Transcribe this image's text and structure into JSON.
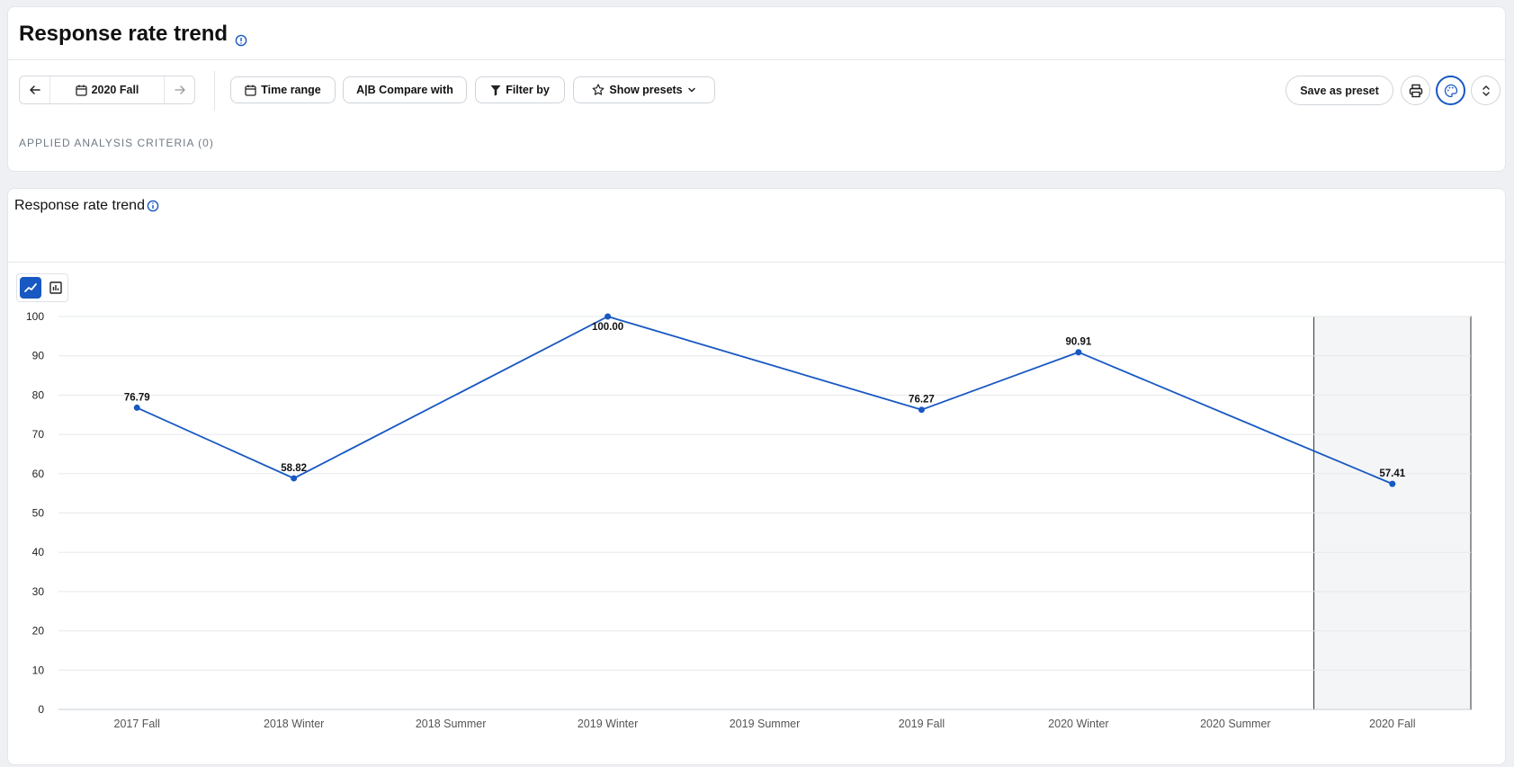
{
  "header": {
    "title": "Response rate trend",
    "period": "2020 Fall",
    "buttons": {
      "time_range": "Time range",
      "compare": "A|B Compare with",
      "filter": "Filter by",
      "presets": "Show presets",
      "save_preset": "Save as preset"
    },
    "criteria": "APPLIED ANALYSIS CRITERIA (0)"
  },
  "chart_card": {
    "title": "Response rate trend"
  },
  "colors": {
    "accent": "#1858c2",
    "highlight_band": "#f4f5f6"
  },
  "chart_data": {
    "type": "line",
    "categories": [
      "2017 Fall",
      "2018 Winter",
      "2018 Summer",
      "2019 Winter",
      "2019 Summer",
      "2019 Fall",
      "2020 Winter",
      "2020 Summer",
      "2020 Fall"
    ],
    "values": [
      76.79,
      58.82,
      null,
      100.0,
      null,
      76.27,
      90.91,
      null,
      57.41
    ],
    "value_labels": [
      "76.79",
      "58.82",
      "",
      "100.00",
      "",
      "76.27",
      "90.91",
      "",
      "57.41"
    ],
    "y_ticks": [
      "0",
      "10",
      "20",
      "30",
      "40",
      "50",
      "60",
      "70",
      "80",
      "90",
      "100"
    ],
    "ylim": [
      0,
      100
    ],
    "highlighted_category": "2020 Fall",
    "grid": true
  }
}
